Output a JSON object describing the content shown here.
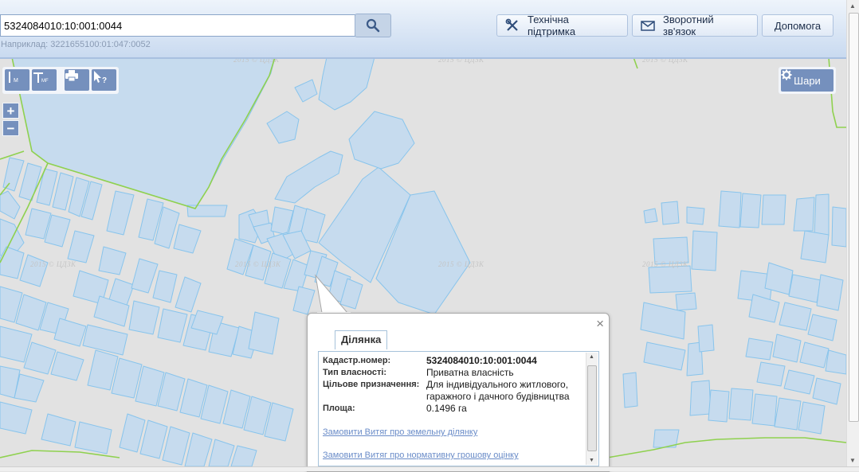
{
  "search": {
    "value": "5324084010:10:001:0044",
    "hint": "Наприклад: 3221655100:01:047:0052",
    "button_icon": "search-icon"
  },
  "header_buttons": {
    "support": "Технічна підтримка",
    "feedback": "Зворотний зв'язок",
    "help": "Допомога"
  },
  "toolbar": {
    "ruler_sub": "M",
    "area_sub": "MF",
    "zoom_in": "+",
    "zoom_out": "−",
    "icons": [
      "ruler-icon",
      "area-measure-icon",
      "print-icon",
      "identify-icon"
    ]
  },
  "layers_button": {
    "label": "Шари",
    "icon": "gear-icon"
  },
  "watermark": "2015 © ЦДЗК",
  "popup": {
    "tab": "Ділянка",
    "close": "×",
    "fields": {
      "cadastral_label": "Кадастр.номер:",
      "cadastral_value": "5324084010:10:001:0044",
      "ownership_label": "Тип власності:",
      "ownership_value": "Приватна власність",
      "purpose_label": "Цільове призначення:",
      "purpose_value": "Для індивідуального житлового, гаражного і дачного будівництва",
      "area_label": "Площа:",
      "area_value": "0.1496 га"
    },
    "link_extract": "Замовити Витяг про земельну ділянку",
    "link_valuation": "Замовити Витяг про нормативну грошову оцінку"
  },
  "colors": {
    "parcel_fill": "#c6dbee",
    "parcel_stroke": "#88c4ec",
    "boundary": "#8fd14f",
    "map_bg": "#e2e2e2",
    "tool_button": "#7590bd"
  }
}
